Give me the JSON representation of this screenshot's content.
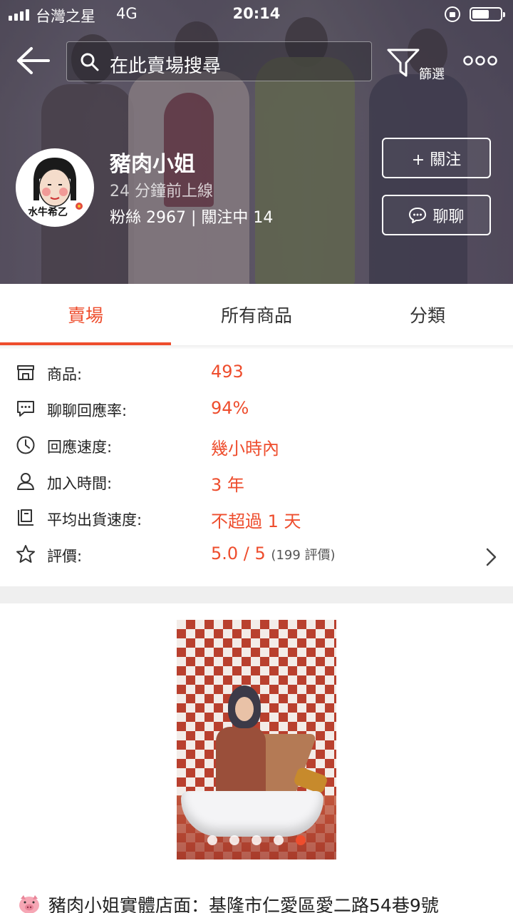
{
  "status_bar": {
    "carrier": "台灣之星",
    "network": "4G",
    "time": "20:14",
    "battery_level": 0.6
  },
  "header": {
    "search_placeholder": "在此賣場搜尋",
    "filter_label": "篩選",
    "shop_name": "豬肉小姐",
    "online_status": "24 分鐘前上線",
    "followers_text": "粉絲 2967 | 關注中 14",
    "follow_label": "+ 關注",
    "chat_label": "聊聊",
    "avatar_text": "水牛希乙"
  },
  "tabs": [
    {
      "label": "賣場",
      "active": true
    },
    {
      "label": "所有商品",
      "active": false
    },
    {
      "label": "分類",
      "active": false
    }
  ],
  "stats": [
    {
      "icon": "shop-icon",
      "label": "商品:",
      "value": "493"
    },
    {
      "icon": "chat-bubble-icon",
      "label": "聊聊回應率:",
      "value": "94%"
    },
    {
      "icon": "clock-icon",
      "label": "回應速度:",
      "value": "幾小時內"
    },
    {
      "icon": "user-icon",
      "label": "加入時間:",
      "value": "3 年"
    },
    {
      "icon": "shipping-icon",
      "label": "平均出貨速度:",
      "value": "不超過 1 天"
    },
    {
      "icon": "star-icon",
      "label": "評價:",
      "value": "5.0 / 5",
      "sub": "(199 評價)"
    }
  ],
  "carousel": {
    "dot_count": 5,
    "active_index": 4
  },
  "description": "豬肉小姐實體店面：基隆市仁愛區愛二路54巷9號",
  "colors": {
    "accent": "#ee4d2d",
    "divider": "#efefef"
  }
}
